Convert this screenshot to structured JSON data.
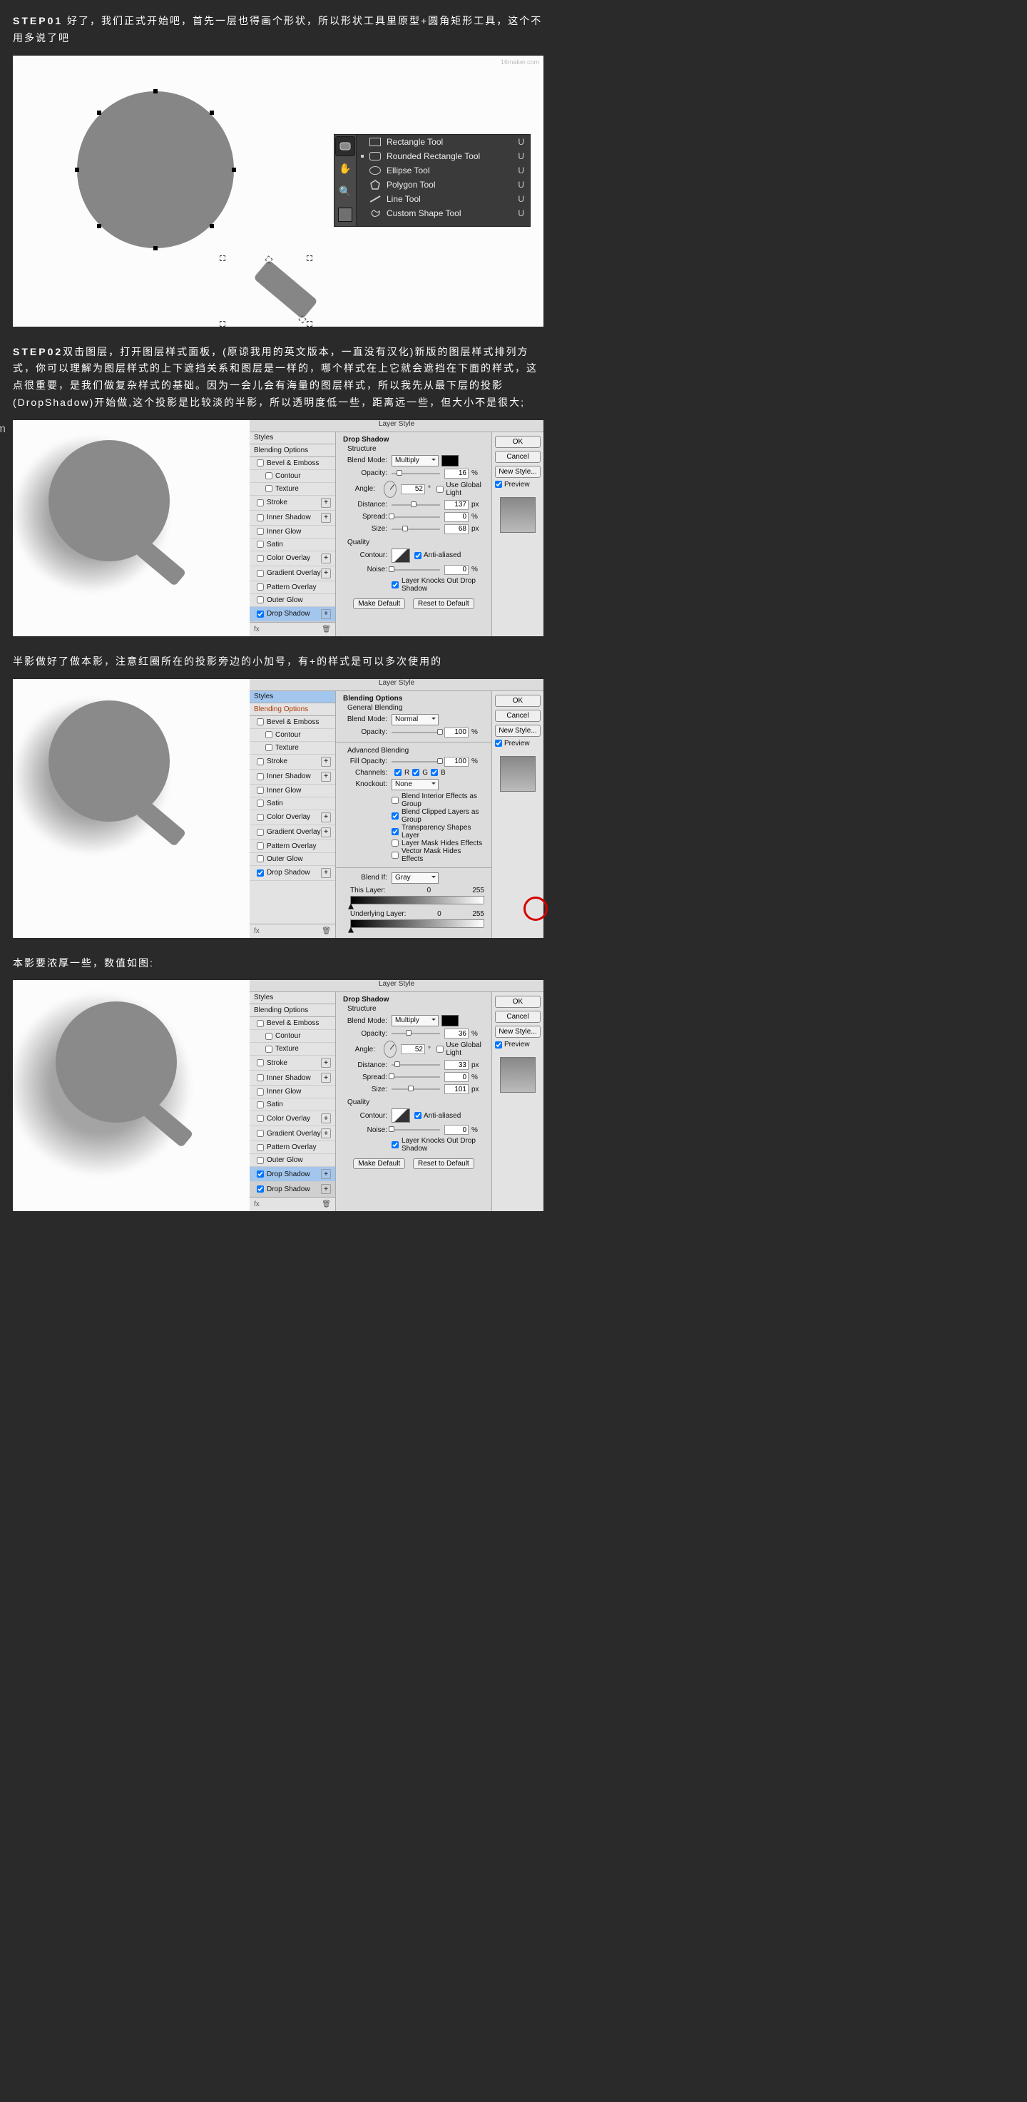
{
  "watermark": "16maker.com",
  "step1": {
    "label": "STEP01",
    "text": " 好了，我们正式开始吧，首先一层也得画个形状，所以形状工具里原型+圆角矩形工具，这个不用多说了吧"
  },
  "tools": {
    "items": [
      {
        "name": "Rectangle Tool",
        "key": "U"
      },
      {
        "name": "Rounded Rectangle Tool",
        "key": "U",
        "active": true
      },
      {
        "name": "Ellipse Tool",
        "key": "U"
      },
      {
        "name": "Polygon Tool",
        "key": "U"
      },
      {
        "name": "Line Tool",
        "key": "U"
      },
      {
        "name": "Custom Shape Tool",
        "key": "U"
      }
    ]
  },
  "step2": {
    "label": "STEP02",
    "text": "双击图层，打开图层样式面板，(原谅我用的英文版本，一直没有汉化)新版的图层样式排列方式，你可以理解为图层样式的上下遮挡关系和图层是一样的，哪个样式在上它就会遮挡在下面的样式，这点很重要，是我们做复杂样式的基础。因为一会儿会有海量的图层样式，所以我先从最下层的投影(DropShadow)开始做,这个投影是比较淡的半影，所以透明度低一些，距离远一些，但大小不是很大;"
  },
  "layerStyle": {
    "title": "Layer Style",
    "left": {
      "stylesTitle": "Styles",
      "blendingOptions": "Blending Options",
      "items": {
        "bevel": "Bevel & Emboss",
        "contour": "Contour",
        "texture": "Texture",
        "stroke": "Stroke",
        "innerShadow": "Inner Shadow",
        "innerGlow": "Inner Glow",
        "satin": "Satin",
        "colorOverlay": "Color Overlay",
        "gradientOverlay": "Gradient Overlay",
        "patternOverlay": "Pattern Overlay",
        "outerGlow": "Outer Glow",
        "dropShadow": "Drop Shadow"
      },
      "fx": "fx"
    },
    "dropShadow": {
      "heading": "Drop Shadow",
      "structure": "Structure",
      "blendMode": "Blend Mode:",
      "blendModeValue": "Multiply",
      "opacity": "Opacity:",
      "angle": "Angle:",
      "useGlobal": "Use Global Light",
      "distance": "Distance:",
      "spread": "Spread:",
      "size": "Size:",
      "quality": "Quality",
      "contour": "Contour:",
      "antiAliased": "Anti-aliased",
      "noise": "Noise:",
      "knocks": "Layer Knocks Out Drop Shadow",
      "makeDefault": "Make Default",
      "resetDefault": "Reset to Default",
      "px": "px",
      "pct": "%"
    },
    "blendingOptions": {
      "heading": "Blending Options",
      "general": "General Blending",
      "blendMode": "Blend Mode:",
      "blendModeValue": "Normal",
      "opacity": "Opacity:",
      "advanced": "Advanced Blending",
      "fillOpacity": "Fill Opacity:",
      "channels": "Channels:",
      "knockout": "Knockout:",
      "knockoutValue": "None",
      "blendInterior": "Blend Interior Effects as Group",
      "blendClipped": "Blend Clipped Layers as Group",
      "transparencyShapes": "Transparency Shapes Layer",
      "layerMaskHides": "Layer Mask Hides Effects",
      "vectorMaskHides": "Vector Mask Hides Effects",
      "blendIf": "Blend If:",
      "blendIfValue": "Gray",
      "thisLayer": "This Layer:",
      "underlying": "Underlying Layer:",
      "v0": "0",
      "v255": "255",
      "oneHundred": "100",
      "pct": "%"
    },
    "right": {
      "ok": "OK",
      "cancel": "Cancel",
      "newStyle": "New Style...",
      "preview": "Preview"
    },
    "values": {
      "ds1": {
        "opacity": "16",
        "angle": "52",
        "distance": "137",
        "spread": "0",
        "size": "68",
        "noise": "0"
      },
      "ds2": {
        "opacity": "36",
        "angle": "52",
        "distance": "33",
        "spread": "0",
        "size": "101",
        "noise": "0"
      }
    }
  },
  "midText1": "半影做好了做本影，注意红圈所在的投影旁边的小加号，有+的样式是可以多次使用的",
  "midText2": "本影要浓厚一些，数值如图:"
}
